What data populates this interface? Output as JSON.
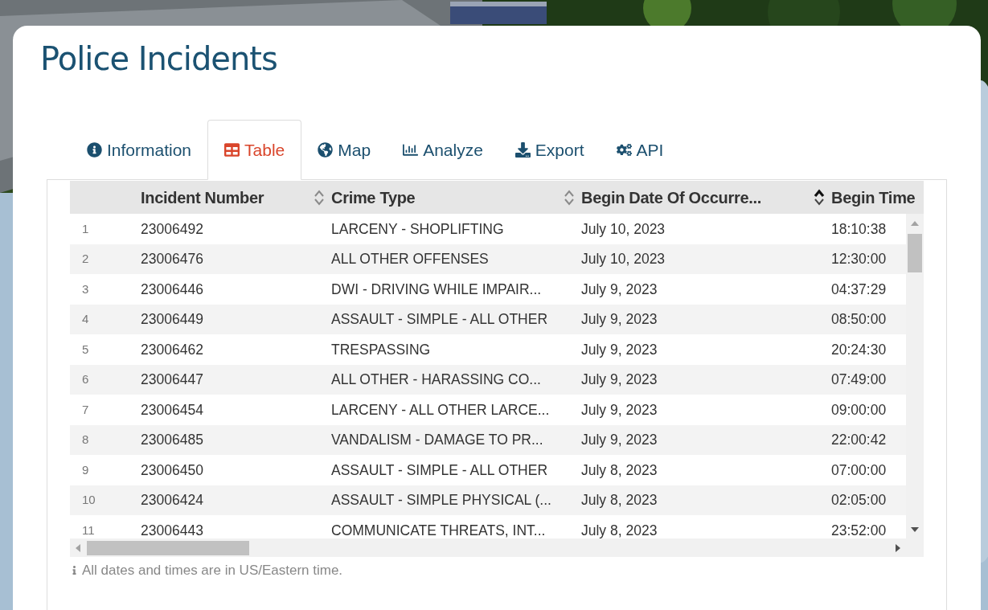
{
  "title": "Police Incidents",
  "tabs": [
    {
      "label": "Information",
      "selected": false
    },
    {
      "label": "Table",
      "selected": true
    },
    {
      "label": "Map",
      "selected": false
    },
    {
      "label": "Analyze",
      "selected": false
    },
    {
      "label": "Export",
      "selected": false
    },
    {
      "label": "API",
      "selected": false
    }
  ],
  "table": {
    "columns": [
      {
        "label": "Incident Number",
        "sorted": false
      },
      {
        "label": "Crime Type",
        "sorted": false
      },
      {
        "label": "Begin Date Of Occurre...",
        "sorted": true
      },
      {
        "label": "Begin Time"
      }
    ],
    "rows": [
      {
        "number": "1",
        "cells": [
          "23006492",
          "LARCENY - SHOPLIFTING",
          "July 10, 2023",
          "18:10:38"
        ]
      },
      {
        "number": "2",
        "cells": [
          "23006476",
          "ALL OTHER OFFENSES",
          "July 10, 2023",
          "12:30:00"
        ]
      },
      {
        "number": "3",
        "cells": [
          "23006446",
          "DWI - DRIVING WHILE IMPAIR...",
          "July 9, 2023",
          "04:37:29"
        ]
      },
      {
        "number": "4",
        "cells": [
          "23006449",
          "ASSAULT - SIMPLE - ALL OTHER",
          "July 9, 2023",
          "08:50:00"
        ]
      },
      {
        "number": "5",
        "cells": [
          "23006462",
          "TRESPASSING",
          "July 9, 2023",
          "20:24:30"
        ]
      },
      {
        "number": "6",
        "cells": [
          "23006447",
          "ALL OTHER - HARASSING CO...",
          "July 9, 2023",
          "07:49:00"
        ]
      },
      {
        "number": "7",
        "cells": [
          "23006454",
          "LARCENY - ALL OTHER LARCE...",
          "July 9, 2023",
          "09:00:00"
        ]
      },
      {
        "number": "8",
        "cells": [
          "23006485",
          "VANDALISM - DAMAGE TO PR...",
          "July 9, 2023",
          "22:00:42"
        ]
      },
      {
        "number": "9",
        "cells": [
          "23006450",
          "ASSAULT - SIMPLE - ALL OTHER",
          "July 8, 2023",
          "07:00:00"
        ]
      },
      {
        "number": "10",
        "cells": [
          "23006424",
          "ASSAULT - SIMPLE PHYSICAL (...",
          "July 8, 2023",
          "02:05:00"
        ]
      },
      {
        "number": "11",
        "cells": [
          "23006443",
          "COMMUNICATE THREATS, INT...",
          "July 8, 2023",
          "23:52:00"
        ]
      }
    ]
  },
  "footnote": "All dates and times are in US/Eastern time."
}
